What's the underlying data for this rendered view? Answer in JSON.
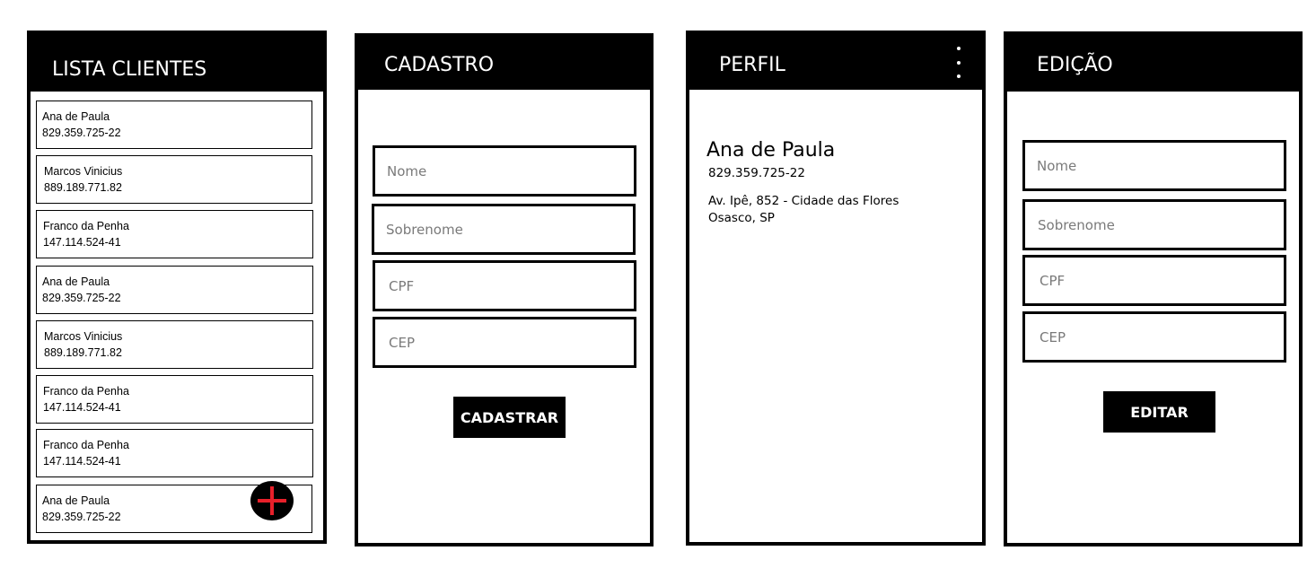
{
  "colors": {
    "bar": "#000000",
    "fab_plus": "#e8202a",
    "placeholder": "#7a7a7a"
  },
  "lista": {
    "title": "LISTA CLIENTES",
    "items": [
      {
        "name": "Ana de Paula",
        "cpf": "829.359.725-22"
      },
      {
        "name": "Marcos Vinicius",
        "cpf": "889.189.771.82"
      },
      {
        "name": "Franco da Penha",
        "cpf": "147.114.524-41"
      },
      {
        "name": "Ana de Paula",
        "cpf": "829.359.725-22"
      },
      {
        "name": "Marcos Vinicius",
        "cpf": "889.189.771.82"
      },
      {
        "name": "Franco da Penha",
        "cpf": "147.114.524-41"
      },
      {
        "name": "Franco da Penha",
        "cpf": "147.114.524-41"
      },
      {
        "name": "Ana de Paula",
        "cpf": "829.359.725-22"
      }
    ],
    "fab_icon": "plus-icon"
  },
  "cadastro": {
    "title": "CADASTRO",
    "fields": {
      "nome": {
        "placeholder": "Nome",
        "value": ""
      },
      "sobrenome": {
        "placeholder": "Sobrenome",
        "value": ""
      },
      "cpf": {
        "placeholder": "CPF",
        "value": ""
      },
      "cep": {
        "placeholder": "CEP",
        "value": ""
      }
    },
    "button": "CADASTRAR"
  },
  "perfil": {
    "title": "PERFIL",
    "menu_icon": "more-vertical-icon",
    "name": "Ana de Paula",
    "cpf": "829.359.725-22",
    "address_line1": "Av. Ipê, 852 - Cidade das Flores",
    "address_line2": "Osasco, SP"
  },
  "edicao": {
    "title": "EDIÇÃO",
    "fields": {
      "nome": {
        "placeholder": "Nome",
        "value": ""
      },
      "sobrenome": {
        "placeholder": "Sobrenome",
        "value": ""
      },
      "cpf": {
        "placeholder": "CPF",
        "value": ""
      },
      "cep": {
        "placeholder": "CEP",
        "value": ""
      }
    },
    "button": "EDITAR"
  }
}
